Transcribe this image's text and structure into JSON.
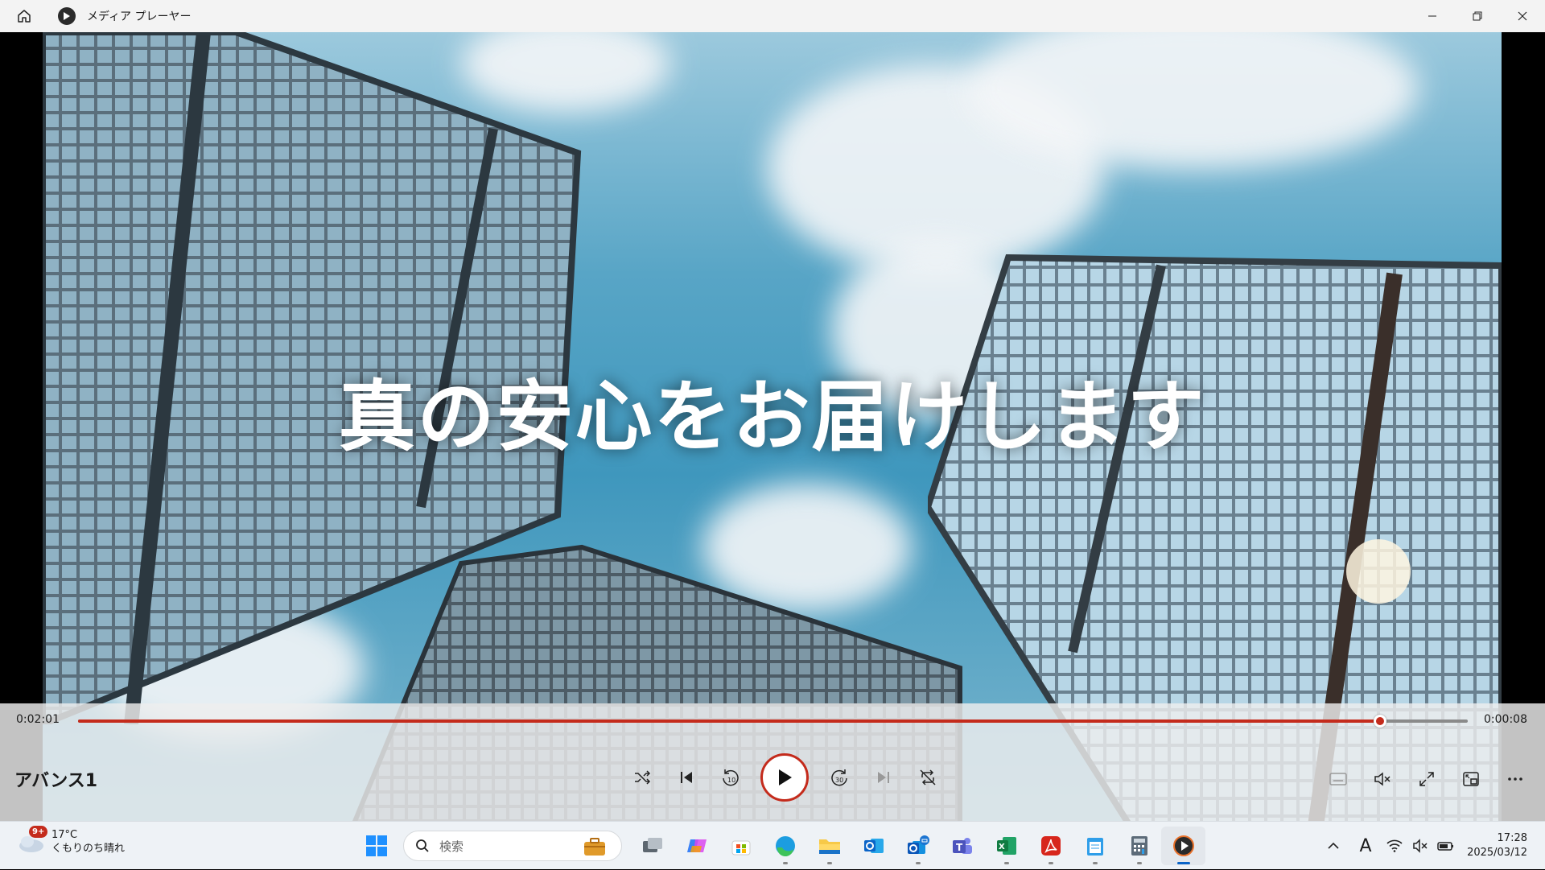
{
  "window": {
    "title": "メディア プレーヤー",
    "icons": [
      "home-icon",
      "media-player-app-icon",
      "minimize-icon",
      "restore-icon",
      "close-icon"
    ]
  },
  "video": {
    "overlay_text": "真の安心をお届けします"
  },
  "player": {
    "elapsed": "0:02:01",
    "remaining": "0:00:08",
    "progress_fraction": 0.937,
    "track_title": "アバンス1",
    "accent_color": "#c42b1c",
    "center_controls": [
      "shuffle-icon",
      "previous-icon",
      "rewind-10-icon",
      "play-icon",
      "forward-30-icon",
      "next-icon",
      "repeat-off-icon"
    ],
    "right_controls": [
      "subtitles-icon",
      "mute-icon",
      "fullscreen-icon",
      "mini-player-icon",
      "more-icon"
    ]
  },
  "taskbar": {
    "weather_badge": "9+",
    "temperature": "17°C",
    "condition": "くもりのち晴れ",
    "search_placeholder": "検索",
    "time": "17:28",
    "date": "2025/03/12",
    "ime": "A",
    "apps": [
      "start",
      "search",
      "task-view",
      "copilot",
      "store",
      "edge",
      "file-explorer",
      "outlook",
      "new-outlook",
      "teams",
      "excel",
      "acrobat",
      "notepad",
      "calculator",
      "media-player"
    ]
  }
}
